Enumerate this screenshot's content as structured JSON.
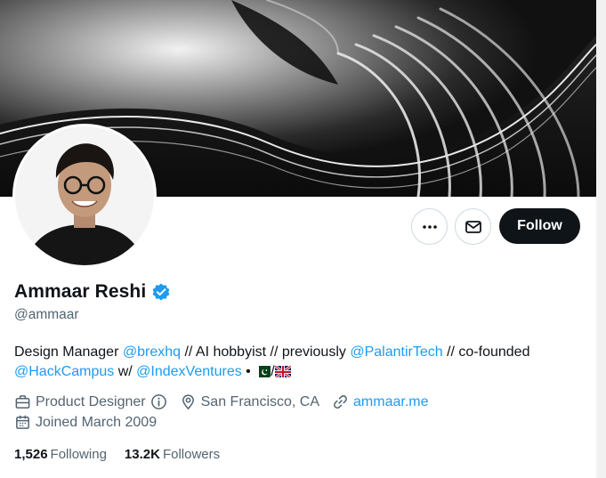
{
  "profile": {
    "name": "Ammaar Reshi",
    "handle": "@ammaar",
    "verified": true
  },
  "actions": {
    "follow_label": "Follow",
    "more_icon": "more-dots-icon",
    "message_icon": "envelope-icon"
  },
  "bio": {
    "t1": "Design Manager ",
    "m1": "@brexhq",
    "t2": " // AI hobbyist // previously ",
    "m2": "@PalantirTech",
    "t3": " // co-founded ",
    "m3": "@HackCampus",
    "t4": " w/ ",
    "m4": "@IndexVentures",
    "t5": " • ",
    "sep": "/",
    "flags": [
      "pakistan-flag",
      "uk-flag"
    ]
  },
  "meta": {
    "profession": "Product Designer",
    "location": "San Francisco, CA",
    "website": "ammaar.me",
    "joined": "Joined March 2009"
  },
  "stats": {
    "following_count": "1,526",
    "following_label": "Following",
    "followers_count": "13.2K",
    "followers_label": "Followers"
  },
  "colors": {
    "link": "#1d9bf0",
    "secondary_text": "#536471",
    "primary_text": "#0f1419",
    "follow_bg": "#0f1419"
  }
}
